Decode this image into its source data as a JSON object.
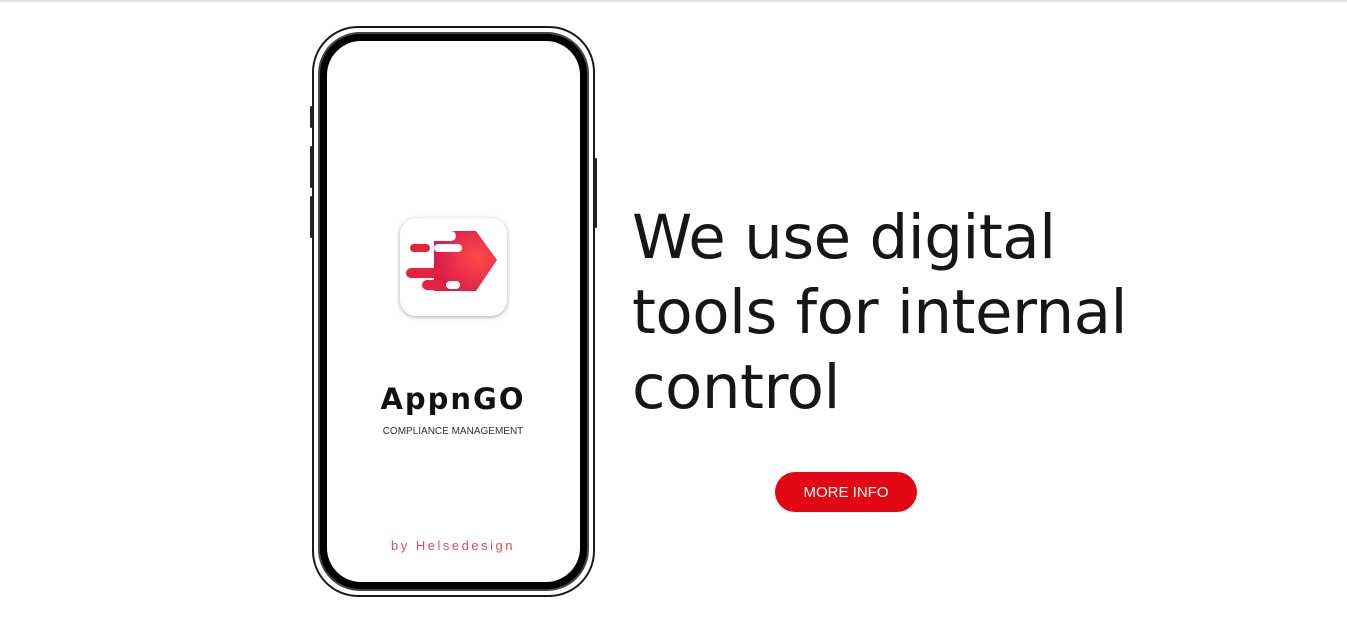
{
  "phone": {
    "app_icon": "appngo-logo-icon",
    "app_name": "AppnGO",
    "app_subtitle": "COMPLIANCE MANAGEMENT",
    "by_line": "by Helsedesign"
  },
  "hero": {
    "headline": "We use digital tools for internal control",
    "button_label": "MORE INFO"
  },
  "colors": {
    "accent": "#e30613",
    "logo_red": "#e8213f",
    "text": "#161616"
  }
}
